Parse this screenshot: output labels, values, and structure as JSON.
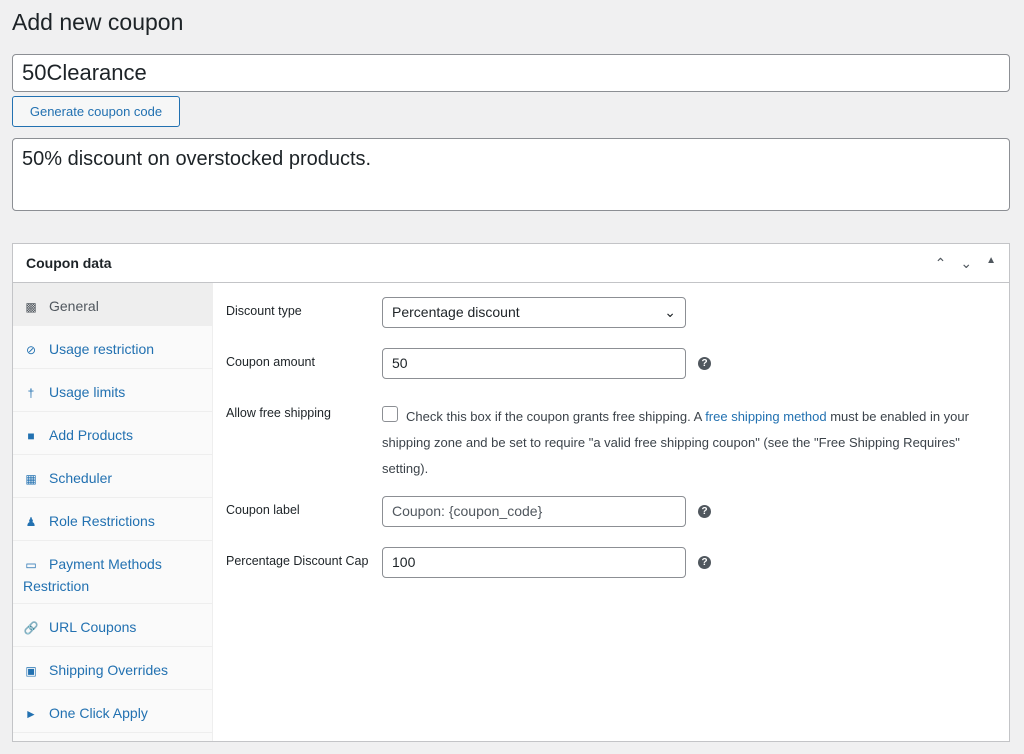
{
  "page": {
    "title": "Add new coupon"
  },
  "coupon": {
    "code": "50Clearance",
    "generate_label": "Generate coupon code",
    "description": "50% discount on overstocked products."
  },
  "panel": {
    "title": "Coupon data",
    "tabs": [
      {
        "label": "General",
        "icon": "ticket-icon"
      },
      {
        "label": "Usage restriction",
        "icon": "block-icon"
      },
      {
        "label": "Usage limits",
        "icon": "limits-icon"
      },
      {
        "label": "Add Products",
        "icon": "bag-icon"
      },
      {
        "label": "Scheduler",
        "icon": "calendar-icon"
      },
      {
        "label": "Role Restrictions",
        "icon": "user-icon"
      },
      {
        "label": "Payment Methods Restriction",
        "icon": "card-icon"
      },
      {
        "label": "URL Coupons",
        "icon": "link-icon"
      },
      {
        "label": "Shipping Overrides",
        "icon": "truck-icon"
      },
      {
        "label": "One Click Apply",
        "icon": "megaphone-icon"
      }
    ]
  },
  "fields": {
    "discount_type": {
      "label": "Discount type",
      "value": "Percentage discount"
    },
    "amount": {
      "label": "Coupon amount",
      "value": "50"
    },
    "free_shipping": {
      "label": "Allow free shipping",
      "checked": false,
      "text_before": "Check this box if the coupon grants free shipping. A ",
      "link": "free shipping method",
      "text_after": " must be enabled in your shipping zone and be set to require \"a valid free shipping coupon\" (see the \"Free Shipping Requires\" setting)."
    },
    "label": {
      "label": "Coupon label",
      "placeholder": "Coupon: {coupon_code}"
    },
    "cap": {
      "label": "Percentage Discount Cap",
      "value": "100"
    }
  }
}
